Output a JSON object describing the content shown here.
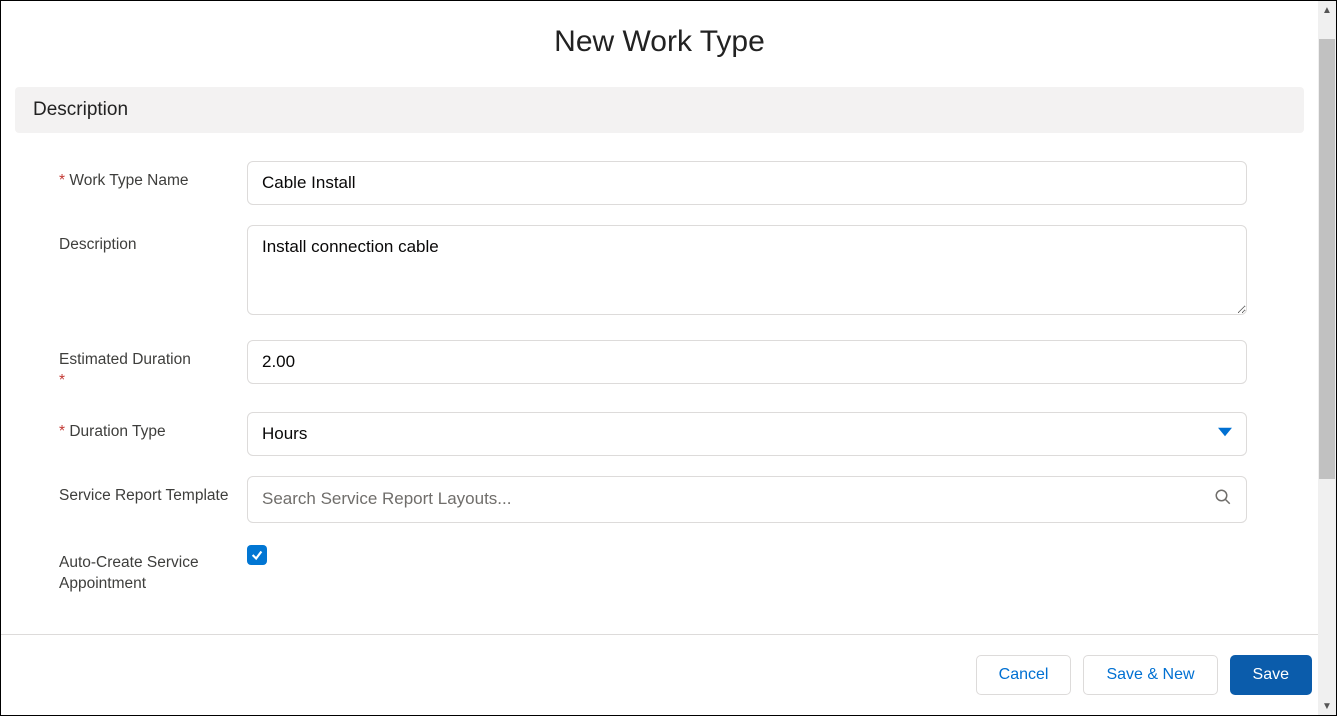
{
  "modal": {
    "title": "New Work Type"
  },
  "section": {
    "header": "Description"
  },
  "fields": {
    "work_type_name": {
      "label": "Work Type Name",
      "value": "Cable Install",
      "required": true
    },
    "description": {
      "label": "Description",
      "value": "Install connection cable",
      "required": false
    },
    "estimated_duration": {
      "label": "Estimated Duration",
      "value": "2.00",
      "required": true
    },
    "duration_type": {
      "label": "Duration Type",
      "value": "Hours",
      "required": true
    },
    "service_report_template": {
      "label": "Service Report Template",
      "placeholder": "Search Service Report Layouts...",
      "required": false
    },
    "auto_create_service_appointment": {
      "label": "Auto-Create Service Appointment",
      "checked": true
    }
  },
  "buttons": {
    "cancel": "Cancel",
    "save_and_new": "Save & New",
    "save": "Save"
  },
  "required_marker": "*"
}
